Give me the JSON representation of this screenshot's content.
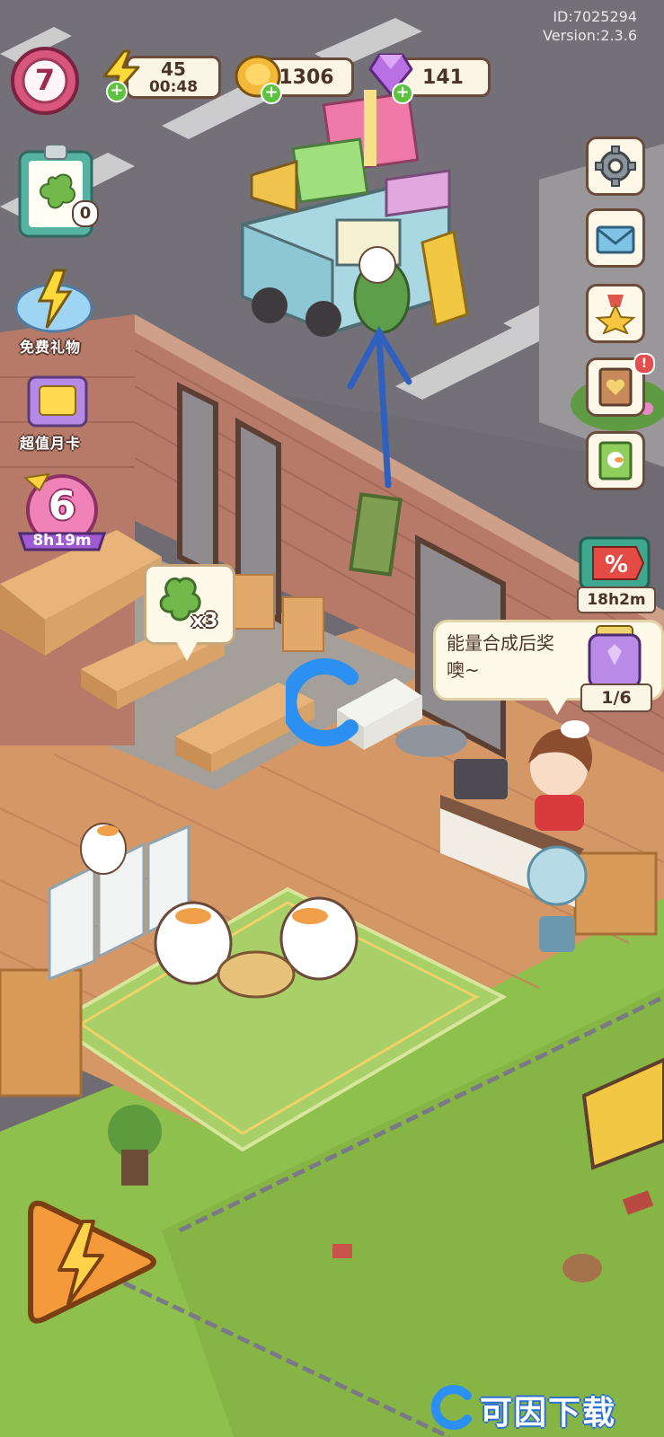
{
  "hud": {
    "player_level": "7",
    "energy_value": "45",
    "energy_timer": "00:48",
    "coins_value": "1306",
    "gems_value": "141",
    "account_id": "ID:7025294",
    "version": "Version:2.3.6"
  },
  "left_panel": {
    "clipboard_count": "0",
    "free_gift_label": "免费礼物",
    "monthly_card_label": "超值月卡",
    "event_level": "6",
    "event_timer": "8h19m"
  },
  "right_panel": {
    "sale_timer": "18h2m",
    "jar_progress": "1/6"
  },
  "speech_bubble": {
    "text_line1": "能量合成后奖",
    "text_line2": "噢~"
  },
  "order_bubble": {
    "count": "x3"
  },
  "watermark": {
    "text": "可因下载"
  },
  "colors": {
    "accent_green": "#5cc23f",
    "brick": "#b87a68",
    "floor": "#d59766",
    "grass": "#8fbf4c",
    "arrow_blue": "#2f5fbf"
  }
}
